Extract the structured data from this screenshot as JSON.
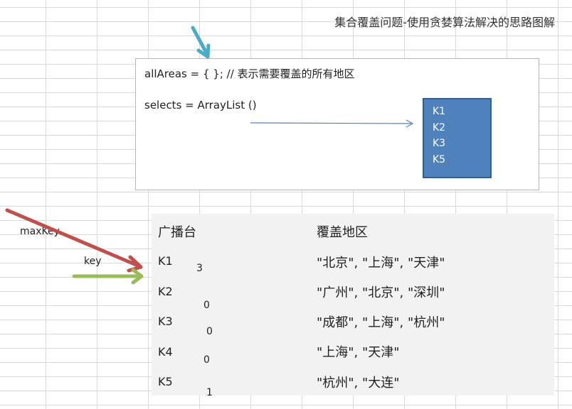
{
  "title": "集合覆盖问题-使用贪婪算法解决的思路图解",
  "code": {
    "all_areas": "allAreas = { }; // 表示需要覆盖的所有地区",
    "selects": "selects  = ArrayList ()"
  },
  "selected_keys": [
    "K1",
    "K2",
    "K3",
    "K5"
  ],
  "labels": {
    "max_key": "maxKey",
    "key": "key"
  },
  "table": {
    "header_station": "广播台",
    "header_areas": "覆盖地区",
    "rows": [
      {
        "key": "K1",
        "count": "3",
        "areas": "\"北京\", \"上海\", \"天津\""
      },
      {
        "key": "K2",
        "count": "0",
        "areas": "\"广州\", \"北京\", \"深圳\""
      },
      {
        "key": "K3",
        "count": "0",
        "areas": "\"成都\", \"上海\", \"杭州\""
      },
      {
        "key": "K4",
        "count": "0",
        "areas": "\"上海\", \"天津\""
      },
      {
        "key": "K5",
        "count": "1",
        "areas": "\"杭州\", \"大连\""
      }
    ]
  },
  "colors": {
    "cyan_arrow": "#4bacc6",
    "red_arrow": "#c0504d",
    "green_arrow": "#9bbb59",
    "blue_arrow": "#4f81bd",
    "box_fill": "#4f81bd"
  }
}
